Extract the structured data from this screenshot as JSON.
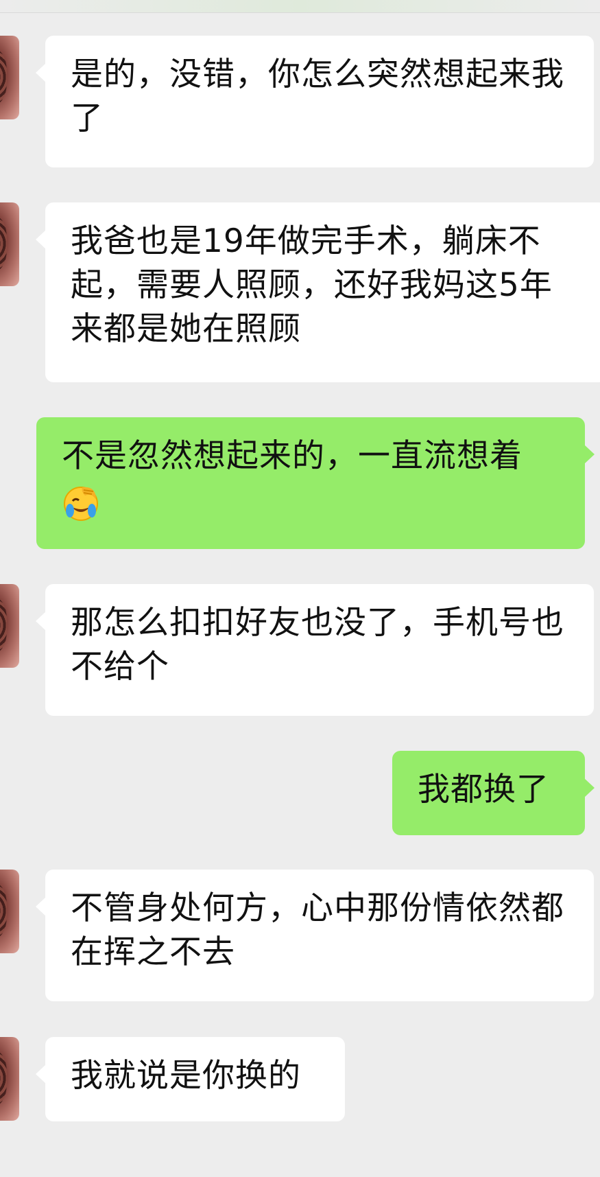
{
  "chat": {
    "messages": [
      {
        "side": "left",
        "text": "是的，没错，你怎么突然想起来我了"
      },
      {
        "side": "left",
        "text": "我爸也是19年做完手术，躺床不起，需要人照顾，还好我妈这5年来都是她在照顾"
      },
      {
        "side": "right",
        "text": "不是忽然想起来的，一直流想着",
        "emoji": "face-palm-laughing-emoji"
      },
      {
        "side": "left",
        "text": "那怎么扣扣好友也没了，手机号也不给个"
      },
      {
        "side": "right",
        "text": "我都换了"
      },
      {
        "side": "left",
        "text": "不管身处何方，心中那份情依然都在挥之不去"
      },
      {
        "side": "left",
        "text": "我就说是你换的"
      }
    ]
  },
  "colors": {
    "background": "#ededed",
    "incoming_bubble": "#ffffff",
    "outgoing_bubble": "#95ec69"
  }
}
